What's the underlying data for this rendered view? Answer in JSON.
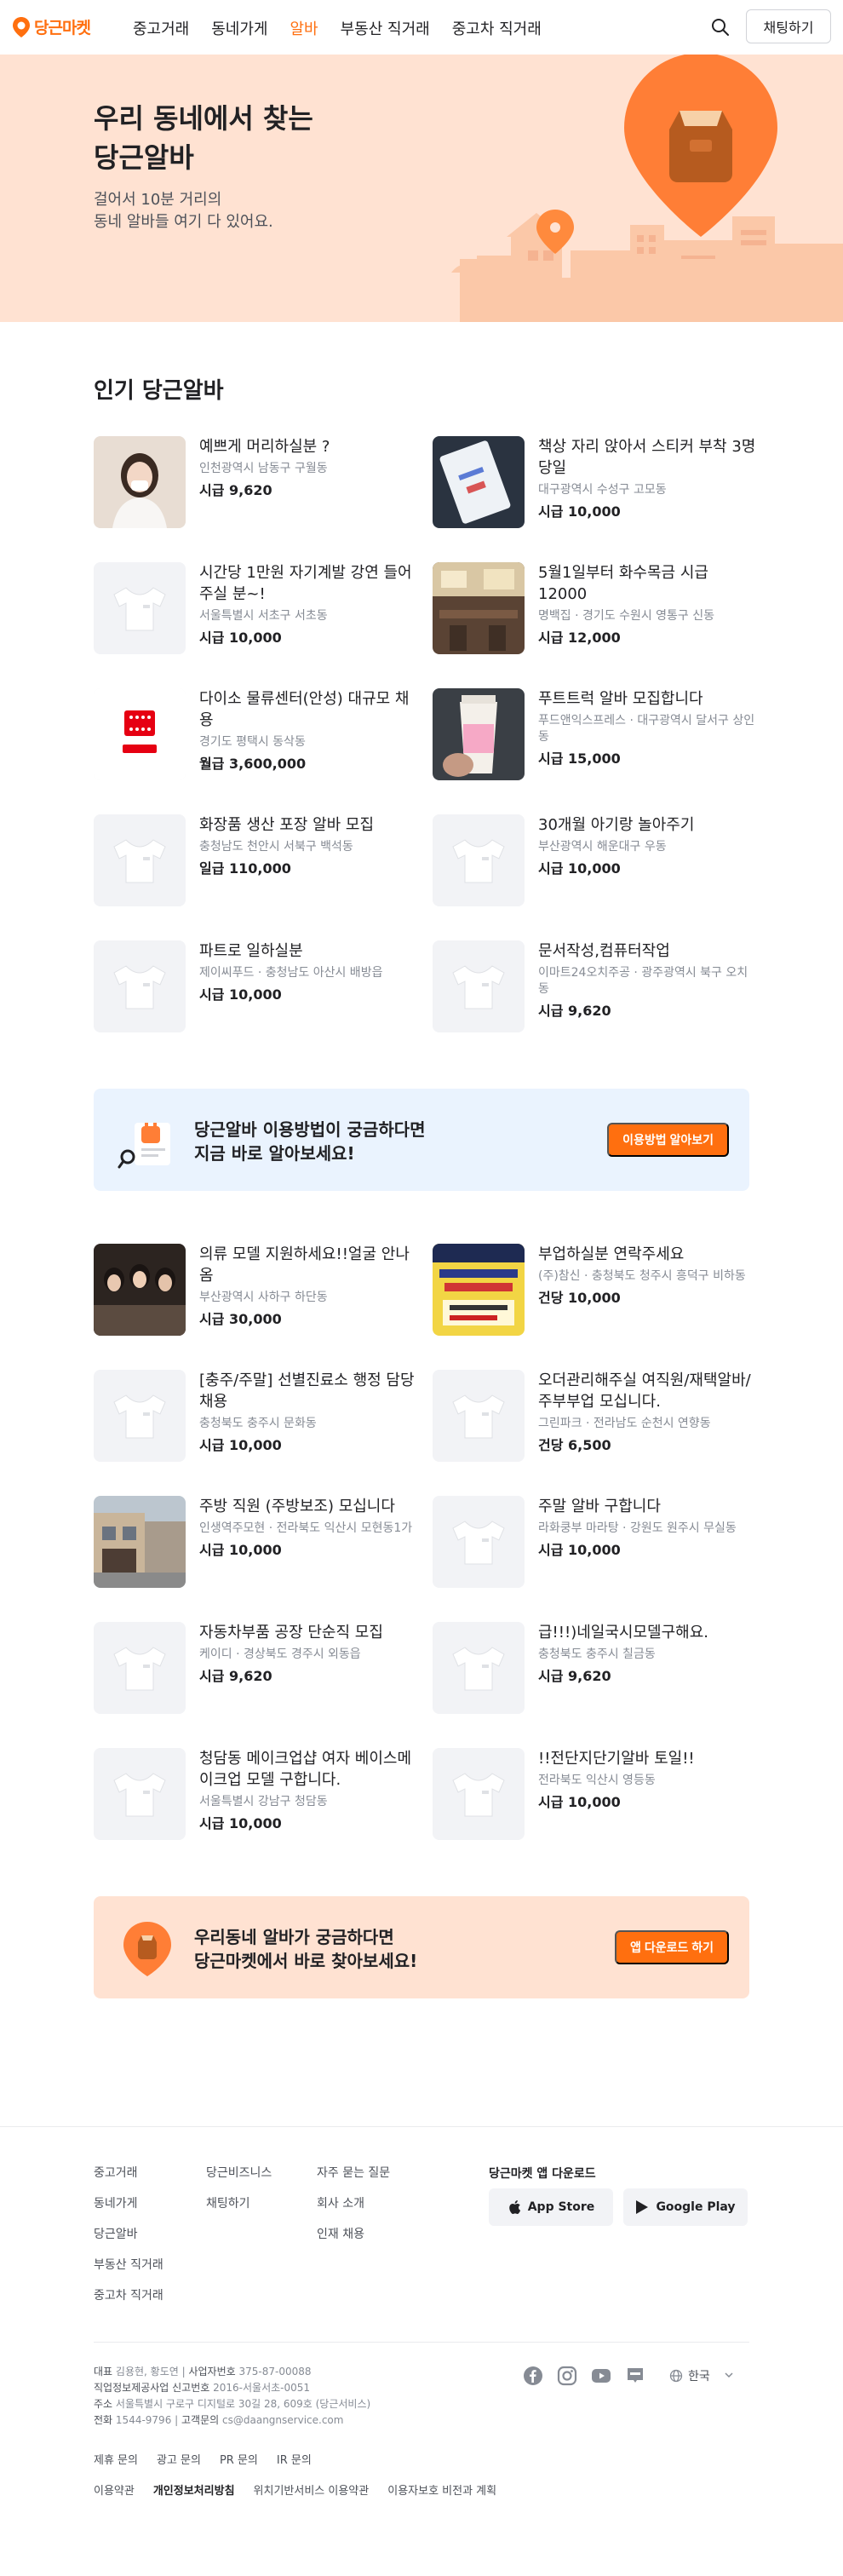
{
  "header": {
    "logo_text": "당근마켓",
    "nav": [
      "중고거래",
      "동네가게",
      "알바",
      "부동산 직거래",
      "중고차 직거래"
    ],
    "chat_label": "채팅하기"
  },
  "hero": {
    "title": "우리 동네에서 찾는\n당근알바",
    "subtitle": "걸어서 10분 거리의\n동네 알바들 여기 다 있어요."
  },
  "section_title": "인기 당근알바",
  "jobs": [
    {
      "title": "예쁘게 머리하실분 ?",
      "location": "인천광역시 남동구 구월동",
      "pay": "시급 9,620",
      "thumb": "photo-woman"
    },
    {
      "title": "책상 자리 앉아서 스티커 부착 3명 당일",
      "location": "대구광역시 수성구 고모동",
      "pay": "시급 10,000",
      "thumb": "photo-stickers"
    },
    {
      "title": "시간당 1만원 자기계발 강연 들어주실 분~!",
      "location": "서울특별시 서초구 서초동",
      "pay": "시급 10,000",
      "thumb": "placeholder"
    },
    {
      "title": "5월1일부터 화수목금 시급12000",
      "location": "명백집 · 경기도 수원시 영통구 신동",
      "pay": "시급 12,000",
      "thumb": "photo-restaurant"
    },
    {
      "title": "다이소 물류센터(안성) 대규모 채용",
      "location": "경기도 평택시 동삭동",
      "pay": "월급 3,600,000",
      "thumb": "logo-daiso"
    },
    {
      "title": "푸트트럭 알바 모집합니다",
      "location": "푸드앤익스프레스 · 대구광역시 달서구 상인동",
      "pay": "시급 15,000",
      "thumb": "photo-drink"
    },
    {
      "title": "화장품 생산 포장 알바 모집",
      "location": "충청남도 천안시 서북구 백석동",
      "pay": "일급 110,000",
      "thumb": "placeholder"
    },
    {
      "title": "30개월 아기랑 놀아주기",
      "location": "부산광역시 해운대구 우동",
      "pay": "시급 10,000",
      "thumb": "placeholder"
    },
    {
      "title": "파트로 일하실분",
      "location": "제이씨푸드 · 충청남도 아산시 배방읍",
      "pay": "시급 10,000",
      "thumb": "placeholder"
    },
    {
      "title": "문서작성,컴퓨터작업",
      "location": "이마트24오치주공 · 광주광역시 북구 오치동",
      "pay": "시급 9,620",
      "thumb": "placeholder"
    }
  ],
  "banner1": {
    "text": "당근알바 이용방법이 궁금하다면\n지금 바로 알아보세요!",
    "button": "이용방법 알아보기"
  },
  "jobs2": [
    {
      "title": "의류 모델 지원하세요!!얼굴 안나옴",
      "location": "부산광역시 사하구 하단동",
      "pay": "시급 30,000",
      "thumb": "photo-group"
    },
    {
      "title": "부업하실분 연락주세요",
      "location": "(주)참신 · 충청북도 청주시 흥덕구 비하동",
      "pay": "건당 10,000",
      "thumb": "photo-sign"
    },
    {
      "title": "[충주/주말] 선별진료소 행정 담당채용",
      "location": "충청북도 충주시 문화동",
      "pay": "시급 10,000",
      "thumb": "placeholder"
    },
    {
      "title": "오더관리해주실 여직원/재택알바/주부부업 모십니다.",
      "location": "그린파크 · 전라남도 순천시 연향동",
      "pay": "건당 6,500",
      "thumb": "placeholder"
    },
    {
      "title": "주방 직원 (주방보조) 모십니다",
      "location": "인생역주모현 · 전라북도 익산시 모현동1가",
      "pay": "시급 10,000",
      "thumb": "photo-street"
    },
    {
      "title": "주말 알바 구합니다",
      "location": "라화쿵부 마라탕 · 강원도 원주시 무실동",
      "pay": "시급 10,000",
      "thumb": "placeholder"
    },
    {
      "title": "자동차부품 공장 단순직 모집",
      "location": "케이디 · 경상북도 경주시 외동읍",
      "pay": "시급 9,620",
      "thumb": "placeholder"
    },
    {
      "title": "급!!!)네일국시모델구해요.",
      "location": "충청북도 충주시 칠금동",
      "pay": "시급 9,620",
      "thumb": "placeholder"
    },
    {
      "title": "청담동 메이크업샵 여자 베이스메이크업 모델 구합니다.",
      "location": "서울특별시 강남구 청담동",
      "pay": "시급 10,000",
      "thumb": "placeholder"
    },
    {
      "title": "!!전단지단기알바 토일!!",
      "location": "전라북도 익산시 영등동",
      "pay": "시급 10,000",
      "thumb": "placeholder"
    }
  ],
  "banner2": {
    "text": "우리동네 알바가 궁금하다면\n당근마켓에서 바로 찾아보세요!",
    "button": "앱 다운로드 하기"
  },
  "footer": {
    "col1": [
      "중고거래",
      "동네가게",
      "당근알바",
      "부동산 직거래",
      "중고차 직거래"
    ],
    "col2": [
      "당근비즈니스",
      "채팅하기"
    ],
    "col3": [
      "자주 묻는 질문",
      "회사 소개",
      "인재 채용"
    ],
    "apps_title": "당근마켓 앱 다운로드",
    "app_store": "App Store",
    "google_play": "Google Play",
    "info_line1_label": "대표",
    "info_line1": "김용현, 황도연",
    "info_line1b_label": "사업자번호",
    "info_line1b": "375-87-00088",
    "info_line2_label": "직업정보제공사업 신고번호",
    "info_line2": "2016-서울서초-0051",
    "info_line3_label": "주소",
    "info_line3": "서울특별시 구로구 디지털로 30길 28, 609호 (당근서비스)",
    "info_line4_label": "전화",
    "info_line4": "1544-9796",
    "info_line4b_label": "고객문의",
    "info_line4b": "cs@daangnservice.com",
    "links1": [
      "제휴 문의",
      "광고 문의",
      "PR 문의",
      "IR 문의"
    ],
    "links2": [
      "이용약관",
      "개인정보처리방침",
      "위치기반서비스 이용약관",
      "이용자보호 비전과 계획"
    ],
    "language": "한국"
  },
  "colors": {
    "brand": "#ff6f0f",
    "hero_bg": "#ffe2d2",
    "banner1_bg": "#eaf3fe",
    "banner2_bg": "#ffe2d2"
  }
}
